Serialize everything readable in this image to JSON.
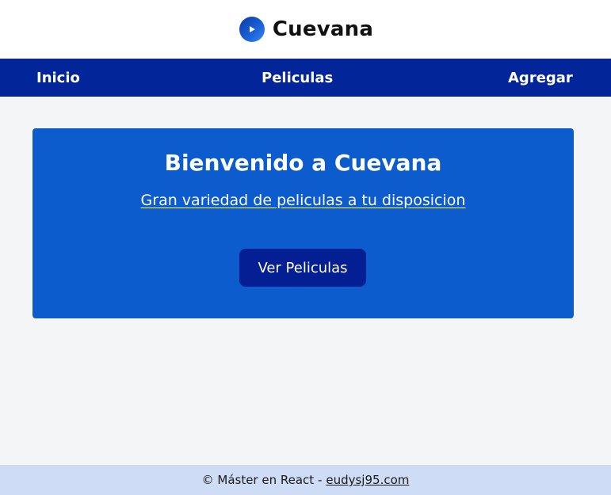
{
  "header": {
    "brand_name": "Cuevana",
    "logo_icon": "play-circle-icon",
    "logo_color": "#0c5ccd"
  },
  "nav": {
    "items": [
      {
        "label": "Inicio"
      },
      {
        "label": "Peliculas"
      },
      {
        "label": "Agregar"
      }
    ],
    "background": "#02269a"
  },
  "hero": {
    "title": "Bienvenido a Cuevana",
    "subtitle": "Gran variedad de peliculas a tu disposicion",
    "button_label": "Ver Peliculas",
    "background": "#0c5ccd",
    "button_color": "#041f93"
  },
  "footer": {
    "text": "© Máster en React -",
    "link_text": "eudysj95.com",
    "background": "#cfdcf5"
  }
}
